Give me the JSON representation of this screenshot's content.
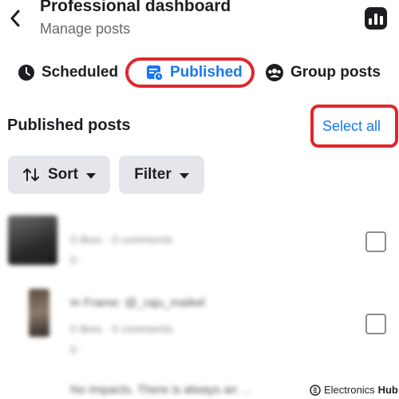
{
  "header": {
    "title": "Professional dashboard",
    "subtitle": "Manage posts"
  },
  "tabs": [
    {
      "label": "Scheduled",
      "icon": "clock-icon",
      "active": false
    },
    {
      "label": "Published",
      "icon": "published-list-icon",
      "active": true
    },
    {
      "label": "Group posts",
      "icon": "group-icon",
      "active": false
    }
  ],
  "section": {
    "title": "Published posts",
    "select_all": "Select all"
  },
  "controls": {
    "sort_label": "Sort",
    "filter_label": "Filter"
  },
  "posts": [
    {
      "line1": "0 likes · 0 comments",
      "line2": "0 ·"
    },
    {
      "caption": "In Frame: @_raju_maikel",
      "line1": "0 likes · 0 comments",
      "line2": "0 ·"
    },
    {
      "caption": "No Impacts. There is always an …"
    }
  ],
  "watermark": {
    "brand1": "Electronics",
    "brand2": "Hub"
  },
  "colors": {
    "accent": "#1877f2",
    "highlight_ring": "#e0262c",
    "chip_bg": "#e4e6eb"
  }
}
